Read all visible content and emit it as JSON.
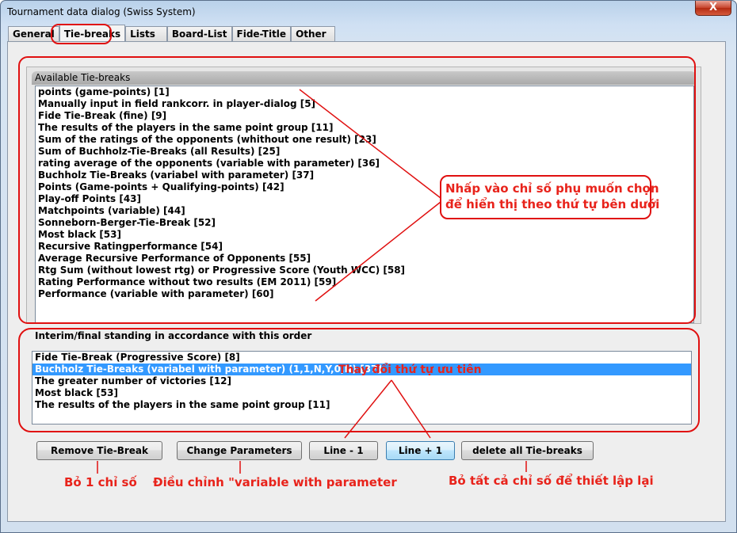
{
  "window": {
    "title": "Tournament data dialog (Swiss System)",
    "close_label": "X"
  },
  "tabs": [
    {
      "label": "General"
    },
    {
      "label": "Tie-breaks"
    },
    {
      "label": "Lists"
    },
    {
      "label": "Board-List"
    },
    {
      "label": "Fide-Title"
    },
    {
      "label": "Other"
    }
  ],
  "available": {
    "title": "Available Tie-breaks",
    "items": [
      "points (game-points) [1]",
      "Manually input in field rankcorr. in player-dialog [5]",
      "Fide Tie-Break (fine) [9]",
      "The results of the players in the same point group [11]",
      "Sum of the ratings of the opponents (whithout one result) [23]",
      "Sum of Buchholz-Tie-Breaks (all Results) [25]",
      "rating average of the opponents (variable with parameter) [36]",
      "Buchholz Tie-Breaks (variabel with parameter) [37]",
      "Points (Game-points + Qualifying-points) [42]",
      "Play-off Points [43]",
      "Matchpoints (variable) [44]",
      "Sonneborn-Berger-Tie-Break [52]",
      "Most black [53]",
      "Recursive Ratingperformance [54]",
      "Average Recursive Performance of Opponents [55]",
      "Rtg Sum (without lowest rtg) or Progressive Score (Youth WCC) [58]",
      "Rating Performance without two results (EM 2011) [59]",
      "Performance (variable with parameter) [60]"
    ]
  },
  "order": {
    "title": "Interim/final standing in accordance with this order",
    "items": [
      "Fide Tie-Break (Progressive Score) [8]",
      "Buchholz Tie-Breaks (variabel with parameter) (1,1,N,Y,0,N)  [37]",
      "The greater number of victories [12]",
      "Most black [53]",
      "The results of the players in the same point group [11]"
    ],
    "selected_index": 1
  },
  "buttons": {
    "remove": "Remove Tie-Break",
    "change_params": "Change Parameters",
    "line_minus": "Line - 1",
    "line_plus": "Line + 1",
    "delete_all": "delete all Tie-breaks"
  },
  "annotations": {
    "click_line1": "Nhấp vào chỉ số phụ muốn chọn",
    "click_line2": "để hiển thị theo thứ tự bên dưới",
    "change_priority": "Thay đổi thứ tự ưu tiên",
    "remove_one": "Bỏ 1 chỉ số",
    "adjust": "Điều chỉnh \"variable with parameter",
    "remove_all": "Bỏ tất cả chỉ số để thiết lập lại"
  },
  "colors": {
    "annotation_red": "#e8231b",
    "selection_blue": "#3399ff"
  }
}
